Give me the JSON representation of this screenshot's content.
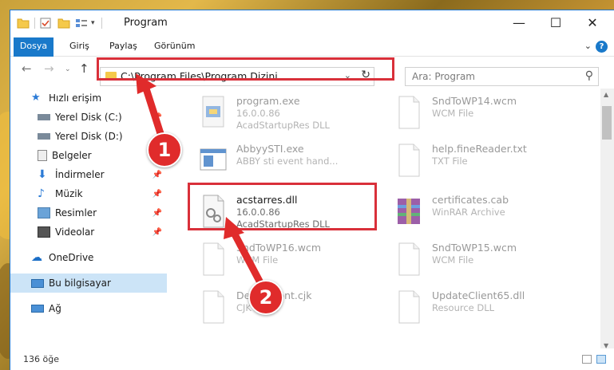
{
  "window": {
    "title": "Program",
    "controls": {
      "minimize": "—",
      "maximize": "☐",
      "close": "✕"
    }
  },
  "ribbon": {
    "tabs": [
      "Dosya",
      "Giriş",
      "Paylaş",
      "Görünüm"
    ],
    "help": "?"
  },
  "nav": {
    "address": "C:\\Program Files\\Program Dizini",
    "search_placeholder": "Ara: Program"
  },
  "sidebar": {
    "items": [
      {
        "label": "Hızlı erişim",
        "icon": "star-icon",
        "pinned": false
      },
      {
        "label": "Yerel Disk (C:)",
        "icon": "drive-icon",
        "pinned": true
      },
      {
        "label": "Yerel Disk (D:)",
        "icon": "drive-icon",
        "pinned": false
      },
      {
        "label": "Belgeler",
        "icon": "documents-icon",
        "pinned": true
      },
      {
        "label": "İndirmeler",
        "icon": "download-icon",
        "pinned": true
      },
      {
        "label": "Müzik",
        "icon": "music-icon",
        "pinned": true
      },
      {
        "label": "Resimler",
        "icon": "pictures-icon",
        "pinned": true
      },
      {
        "label": "Videolar",
        "icon": "videos-icon",
        "pinned": true
      },
      {
        "label": "OneDrive",
        "icon": "cloud-icon",
        "pinned": false
      },
      {
        "label": "Bu bilgisayar",
        "icon": "computer-icon",
        "pinned": false,
        "selected": true
      },
      {
        "label": "Ağ",
        "icon": "network-icon",
        "pinned": false
      }
    ]
  },
  "files": [
    {
      "name": "program.exe",
      "line1": "16.0.0.86",
      "line2": "AcadStartupRes DLL",
      "icon": "exe-icon"
    },
    {
      "name": "SndToWP14.wcm",
      "line1": "WCM File",
      "line2": "",
      "icon": "document-icon"
    },
    {
      "name": "AbbyySTI.exe",
      "line1": "ABBY sti event hand...",
      "line2": "",
      "icon": "app-icon"
    },
    {
      "name": "help.fineReader.txt",
      "line1": "TXT File",
      "line2": "",
      "icon": "document-icon"
    },
    {
      "name": "acstarres.dll",
      "line1": "16.0.0.86",
      "line2": "AcadStartupRes DLL",
      "icon": "dll-gear-icon",
      "highlighted": true
    },
    {
      "name": "certificates.cab",
      "line1": "WinRAR Archive",
      "line2": "",
      "icon": "archive-icon"
    },
    {
      "name": "SndToWP16.wcm",
      "line1": "WCM File",
      "line2": "",
      "icon": "document-icon"
    },
    {
      "name": "SndToWP15.wcm",
      "line1": "WCM File",
      "line2": "",
      "icon": "document-icon"
    },
    {
      "name": "DefaultFont.cjk",
      "line1": "CJK File",
      "line2": "",
      "icon": "document-icon"
    },
    {
      "name": "UpdateClient65.dll",
      "line1": "Resource DLL",
      "line2": "",
      "icon": "document-icon"
    }
  ],
  "status": {
    "count": "136 öğe"
  },
  "annotations": {
    "step1": "1",
    "step2": "2"
  },
  "colors": {
    "accent": "#1979ca",
    "highlight": "#d9303a",
    "selected": "#cce4f7"
  }
}
